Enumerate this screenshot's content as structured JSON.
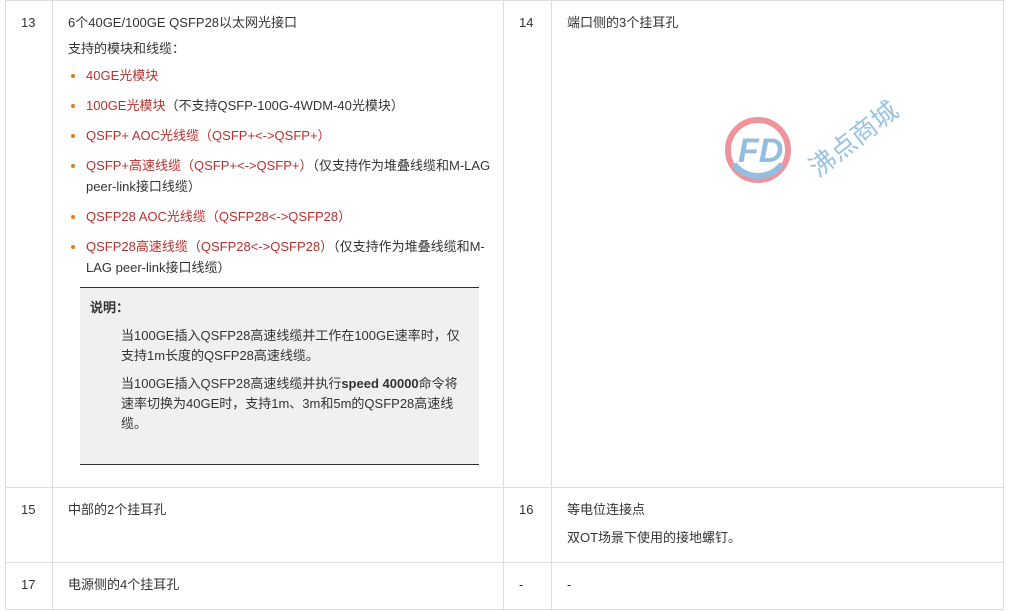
{
  "rows": {
    "r13": {
      "num": "13",
      "title": "6个40GE/100GE QSFP28以太网光接口",
      "subtitle": "支持的模块和线缆：",
      "items": [
        {
          "red": "40GE光模块",
          "rest": ""
        },
        {
          "red": "100GE光模块",
          "rest": "（不支持QSFP-100G-4WDM-40光模块）"
        },
        {
          "red": "QSFP+ AOC光线缆（QSFP+<->QSFP+）",
          "rest": ""
        },
        {
          "red": "QSFP+高速线缆（QSFP+<->QSFP+）",
          "rest": "（仅支持作为堆叠线缆和M-LAG peer-link接口线缆）"
        },
        {
          "red": "QSFP28 AOC光线缆（QSFP28<->QSFP28）",
          "rest": ""
        },
        {
          "red": "QSFP28高速线缆（QSFP28<->QSFP28）",
          "rest": "（仅支持作为堆叠线缆和M-LAG peer-link接口线缆）"
        }
      ],
      "note": {
        "title": "说明：",
        "p1": "当100GE插入QSFP28高速线缆并工作在100GE速率时，仅支持1m长度的QSFP28高速线缆。",
        "p2_before": "当100GE插入QSFP28高速线缆并执行",
        "p2_cmd": "speed 40000",
        "p2_after": "命令将速率切换为40GE时，支持1m、3m和5m的QSFP28高速线缆。"
      }
    },
    "r14": {
      "num": "14",
      "text": "端口侧的3个挂耳孔"
    },
    "r15": {
      "num": "15",
      "text": "中部的2个挂耳孔"
    },
    "r16": {
      "num": "16",
      "text": "等电位连接点",
      "text2": "双OT场景下使用的接地螺钉。"
    },
    "r17": {
      "num": "17",
      "text": "电源侧的4个挂耳孔"
    },
    "r17b": {
      "num": "-",
      "text": "-"
    }
  },
  "watermark": {
    "text": "沸点商城",
    "logo": "FD",
    "icon": "fd-logo-icon"
  }
}
